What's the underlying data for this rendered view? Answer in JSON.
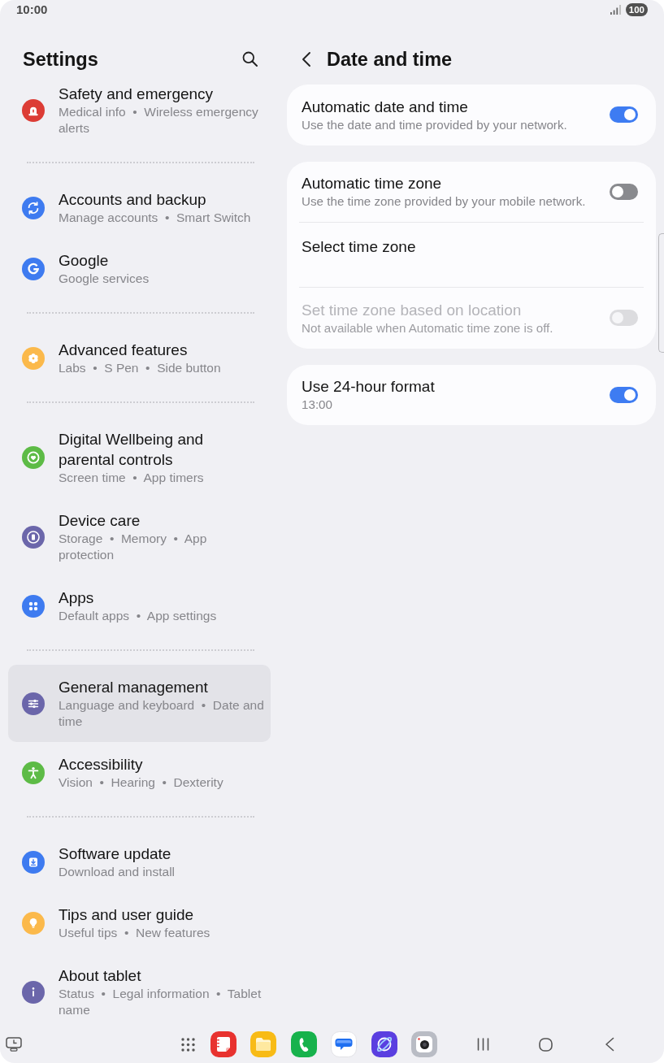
{
  "status_bar": {
    "time": "10:00",
    "battery": "100"
  },
  "sidebar": {
    "title": "Settings",
    "groups": [
      {
        "items": [
          {
            "kind": "siren",
            "color": "#dc3c35",
            "title": "Safety and emergency",
            "subtitle": "Medical info  •  Wireless emergency alerts",
            "selected": false
          }
        ]
      },
      {
        "items": [
          {
            "kind": "sync",
            "color": "#3e7bf0",
            "title": "Accounts and backup",
            "subtitle": "Manage accounts  •  Smart Switch",
            "selected": false
          },
          {
            "kind": "google",
            "color": "#3e7bf0",
            "title": "Google",
            "subtitle": "Google services",
            "selected": false
          }
        ]
      },
      {
        "items": [
          {
            "kind": "flower",
            "color": "#fbb94b",
            "title": "Advanced features",
            "subtitle": "Labs  •  S Pen  •  Side button",
            "selected": false
          }
        ]
      },
      {
        "items": [
          {
            "kind": "heart",
            "color": "#5dbb46",
            "title": "Digital Wellbeing and parental controls",
            "subtitle": "Screen time  •  App timers",
            "selected": false
          },
          {
            "kind": "battery",
            "color": "#6b66aa",
            "title": "Device care",
            "subtitle": "Storage  •  Memory  •  App protection",
            "selected": false
          },
          {
            "kind": "dots",
            "color": "#3e7bf0",
            "title": "Apps",
            "subtitle": "Default apps  •  App settings",
            "selected": false
          }
        ]
      },
      {
        "items": [
          {
            "kind": "sliders",
            "color": "#6b66aa",
            "title": "General management",
            "subtitle": "Language and keyboard  •  Date and time",
            "selected": true
          },
          {
            "kind": "person",
            "color": "#5dbb46",
            "title": "Accessibility",
            "subtitle": "Vision  •  Hearing  •  Dexterity",
            "selected": false
          }
        ]
      },
      {
        "items": [
          {
            "kind": "download",
            "color": "#3e7bf0",
            "title": "Software update",
            "subtitle": "Download and install",
            "selected": false
          },
          {
            "kind": "bulb",
            "color": "#fbb94b",
            "title": "Tips and user guide",
            "subtitle": "Useful tips  •  New features",
            "selected": false
          },
          {
            "kind": "info",
            "color": "#6b66aa",
            "title": "About tablet",
            "subtitle": "Status  •  Legal information  •  Tablet name",
            "selected": false
          }
        ]
      }
    ]
  },
  "detail": {
    "title": "Date and time",
    "cards": [
      {
        "rows": [
          {
            "kind": "switch",
            "title": "Automatic date and time",
            "subtitle": "Use the date and time provided by your network.",
            "on": true,
            "disabled": false
          }
        ]
      },
      {
        "rows": [
          {
            "kind": "switch",
            "title": "Automatic time zone",
            "subtitle": "Use the time zone provided by your mobile network.",
            "on": false,
            "disabled": false
          },
          {
            "kind": "link",
            "title": "Select time zone",
            "disabled": false
          },
          {
            "kind": "switch",
            "title": "Set time zone based on location",
            "subtitle": "Not available when Automatic time zone is off.",
            "on": false,
            "disabled": true
          }
        ]
      },
      {
        "rows": [
          {
            "kind": "switch",
            "title": "Use 24-hour format",
            "subtitle": "13:00",
            "on": true,
            "disabled": false
          }
        ]
      }
    ]
  }
}
